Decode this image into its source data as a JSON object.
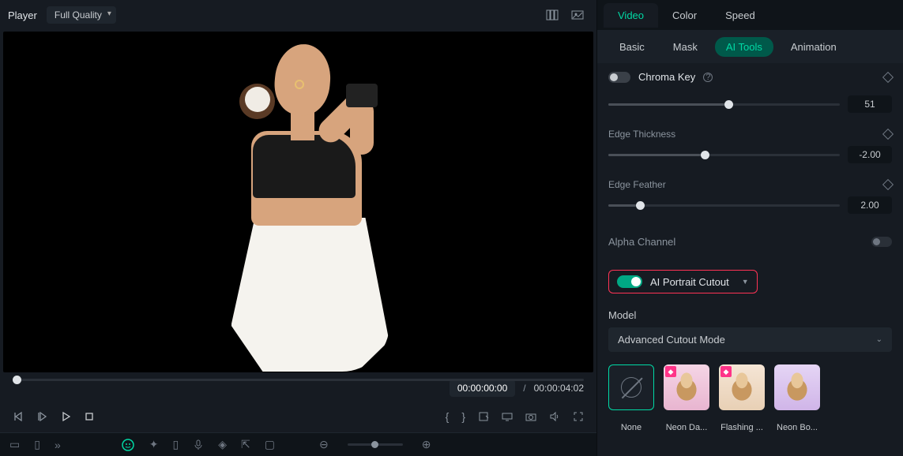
{
  "player": {
    "label": "Player",
    "quality": "Full Quality",
    "current_time": "00:00:00:00",
    "separator": "/",
    "total_time": "00:00:04:02"
  },
  "top_tabs": [
    "Video",
    "Color",
    "Speed"
  ],
  "top_tab_active": "Video",
  "sub_tabs": [
    "Basic",
    "Mask",
    "AI Tools",
    "Animation"
  ],
  "sub_tab_active": "AI Tools",
  "chroma_key": {
    "label": "Chroma Key",
    "enabled": false
  },
  "sliders": [
    {
      "label": "",
      "value": "51",
      "pos": 50
    },
    {
      "label": "Edge Thickness",
      "value": "-2.00",
      "pos": 40
    },
    {
      "label": "Edge Feather",
      "value": "2.00",
      "pos": 12
    }
  ],
  "alpha_channel_label": "Alpha Channel",
  "ai_portrait": {
    "label": "AI Portrait Cutout",
    "enabled": true
  },
  "model": {
    "label": "Model",
    "selected": "Advanced Cutout Mode"
  },
  "presets": [
    "None",
    "Neon Da...",
    "Flashing ...",
    "Neon Bo..."
  ]
}
